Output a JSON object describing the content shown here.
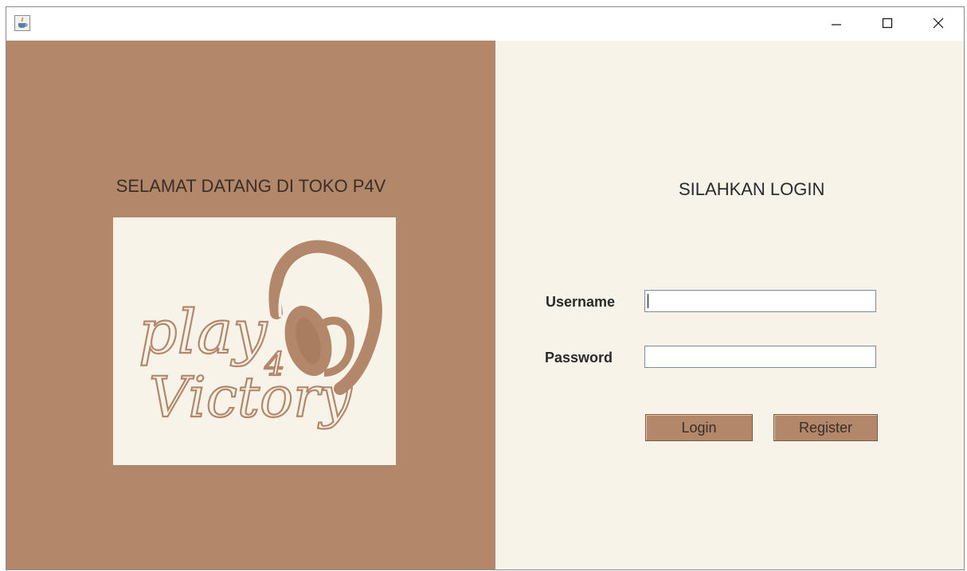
{
  "window": {
    "app_icon": "java-coffee-icon",
    "controls": {
      "minimize_icon": "minimize-icon",
      "maximize_icon": "maximize-icon",
      "close_icon": "close-icon"
    }
  },
  "left": {
    "welcome_text": "SELAMAT DATANG DI TOKO P4V",
    "logo": {
      "line1": "play",
      "line2": "4",
      "line3": "Victory",
      "icon": "headphones-icon"
    }
  },
  "login": {
    "title": "SILAHKAN LOGIN",
    "username_label": "Username",
    "username_value": "",
    "password_label": "Password",
    "password_value": "",
    "login_button": "Login",
    "register_button": "Register"
  },
  "colors": {
    "left_panel": "#b2876a",
    "right_panel": "#f8f3e9",
    "button": "#b2876a"
  }
}
